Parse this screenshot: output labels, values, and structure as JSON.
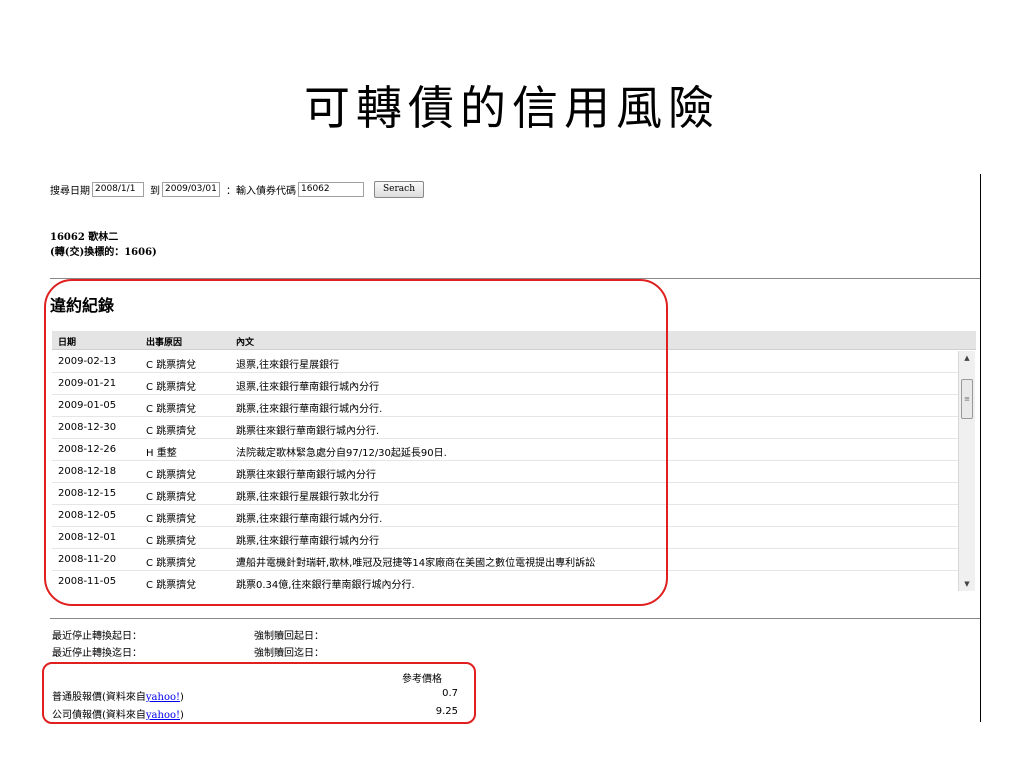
{
  "slide": {
    "title": "可轉債的信用風險"
  },
  "search": {
    "date_label": "搜尋日期",
    "start_date": "2008/1/1",
    "to_label": "到",
    "end_date": "2009/03/01",
    "code_label": "：輸入債券代碼",
    "code_value": "16062",
    "button_label": "Serach"
  },
  "bond": {
    "name_line": "16062 歌林二",
    "underlying_line": "(轉(交)換標的：1606)"
  },
  "default_records": {
    "section_title": "違約紀錄",
    "columns": [
      "日期",
      "出事原因",
      "內文"
    ],
    "rows": [
      {
        "date": "2009-02-13",
        "reason": "C 跳票擠兌",
        "content": "退票,往來銀行星展銀行"
      },
      {
        "date": "2009-01-21",
        "reason": "C 跳票擠兌",
        "content": "退票,往來銀行華南銀行城內分行"
      },
      {
        "date": "2009-01-05",
        "reason": "C 跳票擠兌",
        "content": "跳票,往來銀行華南銀行城內分行."
      },
      {
        "date": "2008-12-30",
        "reason": "C 跳票擠兌",
        "content": "跳票往來銀行華南銀行城內分行."
      },
      {
        "date": "2008-12-26",
        "reason": "H 重整",
        "content": "法院裁定歌林緊急處分自97/12/30起延長90日."
      },
      {
        "date": "2008-12-18",
        "reason": "C 跳票擠兌",
        "content": "跳票往來銀行華南銀行城內分行"
      },
      {
        "date": "2008-12-15",
        "reason": "C 跳票擠兌",
        "content": "跳票,往來銀行星展銀行敦北分行"
      },
      {
        "date": "2008-12-05",
        "reason": "C 跳票擠兌",
        "content": "跳票,往來銀行華南銀行城內分行."
      },
      {
        "date": "2008-12-01",
        "reason": "C 跳票擠兌",
        "content": "跳票,往來銀行華南銀行城內分行"
      },
      {
        "date": "2008-11-20",
        "reason": "C 跳票擠兌",
        "content": "遭船井電機針對瑞軒,歌林,唯冠及冠捷等14家廠商在美國之數位電視提出專利訴訟"
      },
      {
        "date": "2008-11-05",
        "reason": "C 跳票擠兌",
        "content": "跳票0.34億,往來銀行華南銀行城內分行."
      }
    ]
  },
  "conversion": {
    "stop_start_label": "最近停止轉換起日：",
    "stop_end_label": "最近停止轉換迄日：",
    "forced_start_label": "強制贖回起日：",
    "forced_end_label": "強制贖回迄日："
  },
  "prices": {
    "header": "參考價格",
    "stock": {
      "label": "普通股報價(資料來自",
      "link": "yahoo!",
      "suffix": ")",
      "value": "0.7"
    },
    "bond": {
      "label": "公司債報價(資料來自",
      "link": "yahoo!",
      "suffix": ")",
      "value": "9.25"
    }
  },
  "colors": {
    "highlight": "#e02020",
    "header_bg": "#e4e4e4",
    "link": "#0000ee"
  },
  "icons": {
    "scroll_up": "scroll-up-arrow-icon",
    "scroll_down": "scroll-down-arrow-icon"
  }
}
